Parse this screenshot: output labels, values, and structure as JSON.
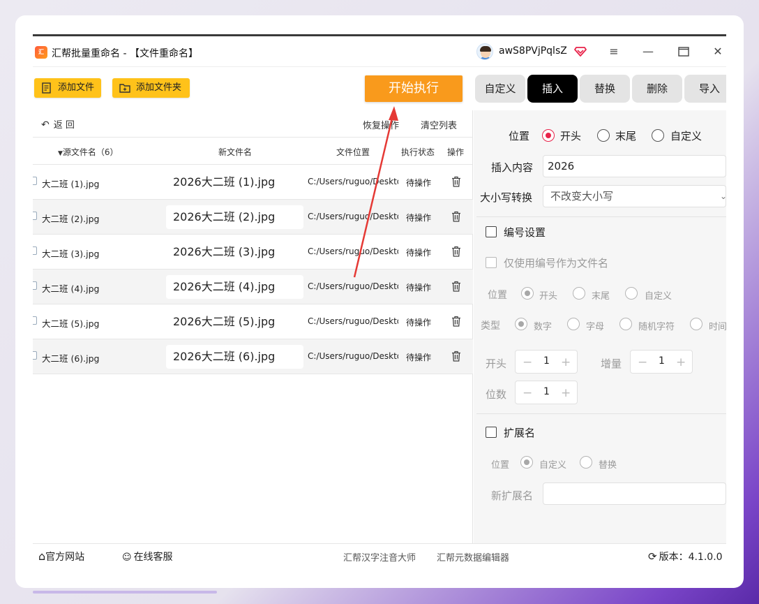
{
  "app": {
    "title": "汇帮批量重命名 - 【文件重命名】",
    "logo_text": "汇",
    "username": "awS8PVjPqlsZ"
  },
  "toolbar": {
    "add_file": "添加文件",
    "add_folder": "添加文件夹",
    "start": "开始执行"
  },
  "tabs": [
    "自定义",
    "插入",
    "替换",
    "删除",
    "导入"
  ],
  "list_actions": {
    "back": "返 回",
    "restore": "恢复操作",
    "clear": "清空列表"
  },
  "table": {
    "headers": {
      "source": "源文件名（6）",
      "new_name": "新文件名",
      "location": "文件位置",
      "status": "执行状态",
      "action": "操作"
    },
    "rows": [
      {
        "source": "大二班 (1).jpg",
        "new_name": "2026大二班 (1).jpg",
        "location": "C:/Users/ruguo/Deskto",
        "status": "待操作"
      },
      {
        "source": "大二班 (2).jpg",
        "new_name": "2026大二班 (2).jpg",
        "location": "C:/Users/ruguo/Deskto",
        "status": "待操作"
      },
      {
        "source": "大二班 (3).jpg",
        "new_name": "2026大二班 (3).jpg",
        "location": "C:/Users/ruguo/Deskto",
        "status": "待操作"
      },
      {
        "source": "大二班 (4).jpg",
        "new_name": "2026大二班 (4).jpg",
        "location": "C:/Users/ruguo/Deskto",
        "status": "待操作"
      },
      {
        "source": "大二班 (5).jpg",
        "new_name": "2026大二班 (5).jpg",
        "location": "C:/Users/ruguo/Deskto",
        "status": "待操作"
      },
      {
        "source": "大二班 (6).jpg",
        "new_name": "2026大二班 (6).jpg",
        "location": "C:/Users/ruguo/Deskto",
        "status": "待操作"
      }
    ]
  },
  "insert_panel": {
    "position_label": "位置",
    "position_options": [
      "开头",
      "末尾",
      "自定义"
    ],
    "position_selected": "开头",
    "content_label": "插入内容",
    "content_value": "2026",
    "case_label": "大小写转换",
    "case_value": "不改变大小写",
    "numbering": {
      "title": "编号设置",
      "only_number_label": "仅使用编号作为文件名",
      "position_label": "位置",
      "position_options": [
        "开头",
        "末尾",
        "自定义"
      ],
      "type_label": "类型",
      "type_options": [
        "数字",
        "字母",
        "随机字符",
        "时间"
      ],
      "start_label": "开头",
      "start_value": "1",
      "step_label": "增量",
      "step_value": "1",
      "digits_label": "位数",
      "digits_value": "1"
    },
    "extension": {
      "title": "扩展名",
      "position_label": "位置",
      "options": [
        "自定义",
        "替换"
      ],
      "new_ext_label": "新扩展名",
      "new_ext_value": ""
    }
  },
  "footer": {
    "website": "官方网站",
    "support": "在线客服",
    "link1": "汇帮汉字注音大师",
    "link2": "汇帮元数据编辑器",
    "version": "版本：4.1.0.0"
  },
  "colors": {
    "accent_yellow": "#ffc21a",
    "start_orange": "#f99a1c",
    "radio_red": "#e8234a",
    "active_tab": "#000000",
    "annotation_arrow": "#e53935"
  }
}
